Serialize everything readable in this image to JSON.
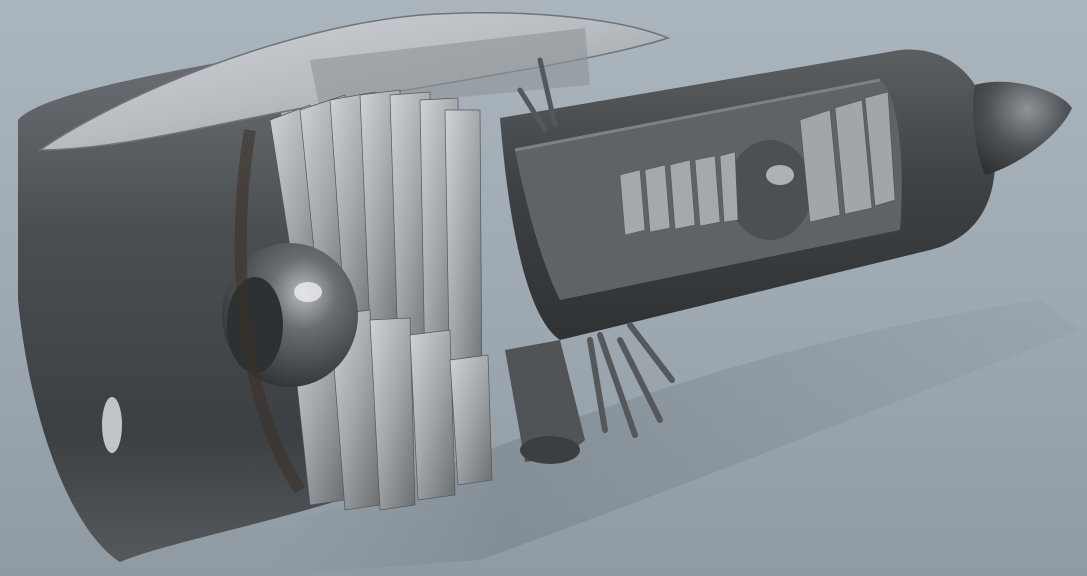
{
  "scene": {
    "subject": "turbofan-engine-cutaway-render",
    "colors": {
      "background_top": "#aab5bd",
      "background_bottom": "#8f9aa2",
      "casing": "#4a4d50",
      "casing_highlight": "#8a8f94",
      "blade": "#a9acaf",
      "blade_dark": "#6c7074",
      "nacelle_top": "#c9cdd0",
      "core_interior": "#5a5d60"
    }
  }
}
